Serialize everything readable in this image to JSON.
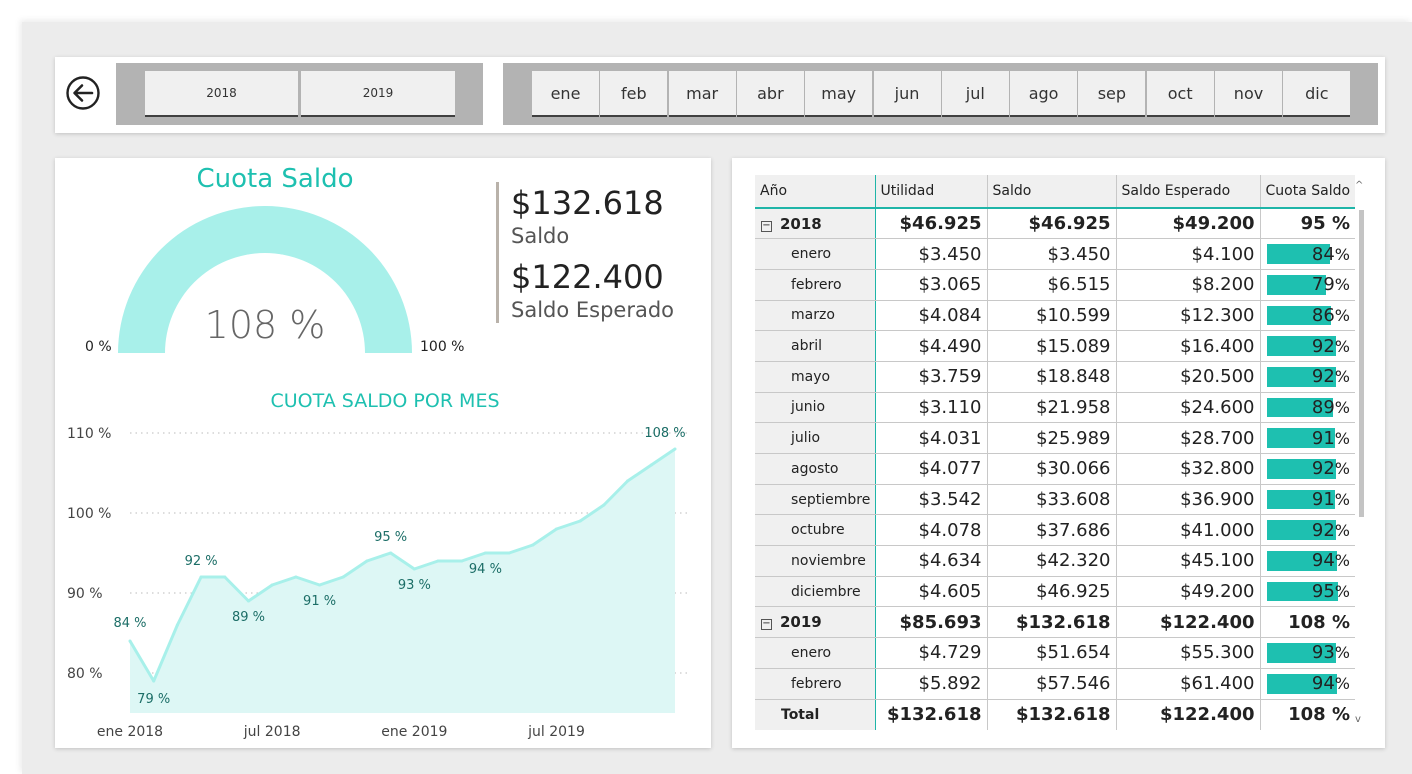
{
  "years": [
    "2018",
    "2019"
  ],
  "months": [
    "ene",
    "feb",
    "mar",
    "abr",
    "may",
    "jun",
    "jul",
    "ago",
    "sep",
    "oct",
    "nov",
    "dic"
  ],
  "gauge": {
    "title": "Cuota Saldo",
    "value_label": "108 %",
    "value_pct": 108,
    "min_label": "0 %",
    "max_label": "100 %"
  },
  "kpis": {
    "saldo_amount": "$132.618",
    "saldo_label": "Saldo",
    "esperado_amount": "$122.400",
    "esperado_label": "Saldo Esperado"
  },
  "chart_data": {
    "type": "area",
    "title": "CUOTA SALDO POR MES",
    "x": [
      "2018-01",
      "2018-02",
      "2018-03",
      "2018-04",
      "2018-05",
      "2018-06",
      "2018-07",
      "2018-08",
      "2018-09",
      "2018-10",
      "2018-11",
      "2018-12",
      "2019-01",
      "2019-02",
      "2019-03",
      "2019-04",
      "2019-05",
      "2019-06",
      "2019-07",
      "2019-08",
      "2019-09",
      "2019-10",
      "2019-11",
      "2019-12"
    ],
    "values": [
      84,
      79,
      86,
      92,
      92,
      89,
      91,
      92,
      91,
      92,
      94,
      95,
      93,
      94,
      94,
      95,
      95,
      96,
      98,
      99,
      101,
      104,
      106,
      108
    ],
    "point_labels": [
      {
        "index": 0,
        "text": "84 %"
      },
      {
        "index": 1,
        "text": "79 %"
      },
      {
        "index": 3,
        "text": "92 %"
      },
      {
        "index": 5,
        "text": "89 %"
      },
      {
        "index": 8,
        "text": "91 %"
      },
      {
        "index": 11,
        "text": "95 %"
      },
      {
        "index": 12,
        "text": "93 %"
      },
      {
        "index": 15,
        "text": "94 %"
      },
      {
        "index": 23,
        "text": "108 %"
      }
    ],
    "yticks": [
      {
        "value": 80,
        "label": "80 %"
      },
      {
        "value": 90,
        "label": "90 %"
      },
      {
        "value": 100,
        "label": "100 %"
      },
      {
        "value": 110,
        "label": "110 %"
      }
    ],
    "xticks": [
      {
        "index": 0,
        "label": "ene 2018"
      },
      {
        "index": 6,
        "label": "jul 2018"
      },
      {
        "index": 12,
        "label": "ene 2019"
      },
      {
        "index": 18,
        "label": "jul 2019"
      }
    ],
    "ylim": [
      75,
      110
    ],
    "grid": true,
    "colors": {
      "line": "#a8f0ea",
      "fill": "#ddf7f5",
      "labels": "#1c6e67"
    }
  },
  "table": {
    "headers": [
      "Año",
      "Utilidad",
      "Saldo",
      "Saldo Esperado",
      "Cuota Saldo"
    ],
    "rows": [
      {
        "type": "year",
        "label": "2018",
        "expander": "−",
        "utilidad": "$46.925",
        "saldo": "$46.925",
        "esperado": "$49.200",
        "cuota": "95 %"
      },
      {
        "type": "month",
        "label": "enero",
        "utilidad": "$3.450",
        "saldo": "$3.450",
        "esperado": "$4.100",
        "cuota_num": "84",
        "cuota_suffix": "%",
        "cuota_pct": 84
      },
      {
        "type": "month",
        "label": "febrero",
        "utilidad": "$3.065",
        "saldo": "$6.515",
        "esperado": "$8.200",
        "cuota_num": "79",
        "cuota_suffix": "%",
        "cuota_pct": 79
      },
      {
        "type": "month",
        "label": "marzo",
        "utilidad": "$4.084",
        "saldo": "$10.599",
        "esperado": "$12.300",
        "cuota_num": "86",
        "cuota_suffix": "%",
        "cuota_pct": 86
      },
      {
        "type": "month",
        "label": "abril",
        "utilidad": "$4.490",
        "saldo": "$15.089",
        "esperado": "$16.400",
        "cuota_num": "92",
        "cuota_suffix": "%",
        "cuota_pct": 92
      },
      {
        "type": "month",
        "label": "mayo",
        "utilidad": "$3.759",
        "saldo": "$18.848",
        "esperado": "$20.500",
        "cuota_num": "92",
        "cuota_suffix": "%",
        "cuota_pct": 92
      },
      {
        "type": "month",
        "label": "junio",
        "utilidad": "$3.110",
        "saldo": "$21.958",
        "esperado": "$24.600",
        "cuota_num": "89",
        "cuota_suffix": "%",
        "cuota_pct": 89
      },
      {
        "type": "month",
        "label": "julio",
        "utilidad": "$4.031",
        "saldo": "$25.989",
        "esperado": "$28.700",
        "cuota_num": "91",
        "cuota_suffix": "%",
        "cuota_pct": 91
      },
      {
        "type": "month",
        "label": "agosto",
        "utilidad": "$4.077",
        "saldo": "$30.066",
        "esperado": "$32.800",
        "cuota_num": "92",
        "cuota_suffix": "%",
        "cuota_pct": 92
      },
      {
        "type": "month",
        "label": "septiembre",
        "utilidad": "$3.542",
        "saldo": "$33.608",
        "esperado": "$36.900",
        "cuota_num": "91",
        "cuota_suffix": "%",
        "cuota_pct": 91
      },
      {
        "type": "month",
        "label": "octubre",
        "utilidad": "$4.078",
        "saldo": "$37.686",
        "esperado": "$41.000",
        "cuota_num": "92",
        "cuota_suffix": "%",
        "cuota_pct": 92
      },
      {
        "type": "month",
        "label": "noviembre",
        "utilidad": "$4.634",
        "saldo": "$42.320",
        "esperado": "$45.100",
        "cuota_num": "94",
        "cuota_suffix": "%",
        "cuota_pct": 94
      },
      {
        "type": "month",
        "label": "diciembre",
        "utilidad": "$4.605",
        "saldo": "$46.925",
        "esperado": "$49.200",
        "cuota_num": "95",
        "cuota_suffix": "%",
        "cuota_pct": 95
      },
      {
        "type": "year",
        "label": "2019",
        "expander": "−",
        "utilidad": "$85.693",
        "saldo": "$132.618",
        "esperado": "$122.400",
        "cuota": "108 %"
      },
      {
        "type": "month",
        "label": "enero",
        "utilidad": "$4.729",
        "saldo": "$51.654",
        "esperado": "$55.300",
        "cuota_num": "93",
        "cuota_suffix": "%",
        "cuota_pct": 93
      },
      {
        "type": "month",
        "label": "febrero",
        "utilidad": "$5.892",
        "saldo": "$57.546",
        "esperado": "$61.400",
        "cuota_num": "94",
        "cuota_suffix": "%",
        "cuota_pct": 94
      }
    ],
    "total": {
      "label": "Total",
      "utilidad": "$132.618",
      "saldo": "$132.618",
      "esperado": "$122.400",
      "cuota": "108 %"
    }
  },
  "colors": {
    "accent": "#1ec0b0",
    "gauge_fill": "#a8f0ea",
    "bar": "#1ec0b0"
  }
}
